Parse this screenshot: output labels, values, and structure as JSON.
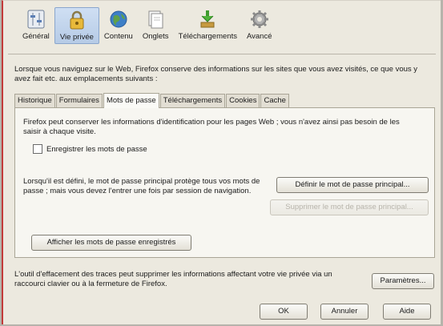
{
  "toolbar": {
    "items": [
      {
        "label": "Général",
        "icon": "general-icon"
      },
      {
        "label": "Vie privée",
        "icon": "privacy-lock-icon"
      },
      {
        "label": "Contenu",
        "icon": "globe-icon"
      },
      {
        "label": "Onglets",
        "icon": "tabs-icon"
      },
      {
        "label": "Téléchargements",
        "icon": "downloads-icon"
      },
      {
        "label": "Avancé",
        "icon": "gear-icon"
      }
    ],
    "active": "Vie privée"
  },
  "intro_text": "Lorsque vous naviguez sur le Web, Firefox conserve des informations sur les sites que vous avez visités, ce que vous y avez fait etc. aux emplacements suivants :",
  "tabs": [
    "Historique",
    "Formulaires",
    "Mots de passe",
    "Téléchargements",
    "Cookies",
    "Cache"
  ],
  "selected_tab": "Mots de passe",
  "passwords": {
    "description": "Firefox peut conserver les informations d'identification pour les pages Web ; vous n'avez ainsi pas besoin de les saisir à chaque visite.",
    "remember_label": "Enregistrer les mots de passe",
    "master_text": "Lorsqu'il est défini, le mot de passe principal protège tous vos mots de passe ; mais vous devez l'entrer une fois par session de navigation.",
    "set_master_button": "Définir le mot de passe principal...",
    "remove_master_button": "Supprimer le mot de passe principal...",
    "show_saved_button": "Afficher les mots de passe enregistrés"
  },
  "footer": {
    "text": "L'outil d'effacement des traces peut supprimer les informations affectant votre vie privée via un raccourci clavier ou à la fermeture de Firefox.",
    "settings_button": "Paramètres..."
  },
  "dialog_buttons": {
    "ok": "OK",
    "cancel": "Annuler",
    "help": "Aide"
  }
}
